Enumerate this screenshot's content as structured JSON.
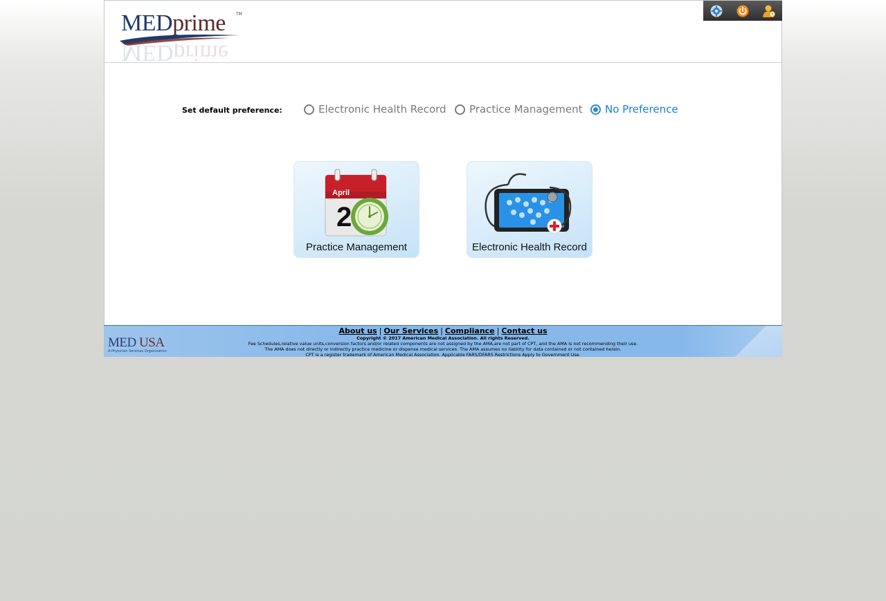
{
  "header": {
    "logo_text_med": "MED",
    "logo_text_prime": "prime",
    "logo_tm": "TM",
    "toolbar": [
      {
        "icon": "settings-gear-icon",
        "color": "#2f7fd8"
      },
      {
        "icon": "power-icon",
        "color": "#f08a1c"
      },
      {
        "icon": "user-icon",
        "color": "#f0a020"
      }
    ]
  },
  "preference": {
    "label": "Set default preference:",
    "options": [
      {
        "label": "Electronic Health Record",
        "selected": false
      },
      {
        "label": "Practice Management",
        "selected": false
      },
      {
        "label": "No Preference",
        "selected": true
      }
    ]
  },
  "tiles": [
    {
      "label": "Practice Management",
      "icon": "calendar-clock-icon",
      "calendar_month": "April",
      "calendar_day": "2"
    },
    {
      "label": "Electronic Health Record",
      "icon": "tablet-stethoscope-icon"
    }
  ],
  "footer": {
    "logo_main_1": "MED",
    "logo_main_2": "USA",
    "logo_sub": "A Physician Services Organization",
    "links": [
      "About us",
      "Our Services",
      "Compliance",
      "Contact us"
    ],
    "copyright": "Copyright © 2017 American Medical Association. All rights Reserved.",
    "line1": "Fee Schedules,relative value units,conversion factors and/or related components are not assigned by the AMA,are not part of CPT, and the AMA is not recommending their use.",
    "line2": "The AMA does not directly or indirectly practice medicine or dispense medical services. The AMA assumes no liability for data contained or not contained herein.",
    "line3": "CPT is a register trademark of American Medical Association. Applicable FARS/DFARS Restrictions Apply to Government Use."
  },
  "colors": {
    "accent_blue": "#1a7ed8",
    "footer_blue": "#86b8ea",
    "brand_navy": "#1f3a6b",
    "brand_maroon": "#5a2a2a"
  }
}
